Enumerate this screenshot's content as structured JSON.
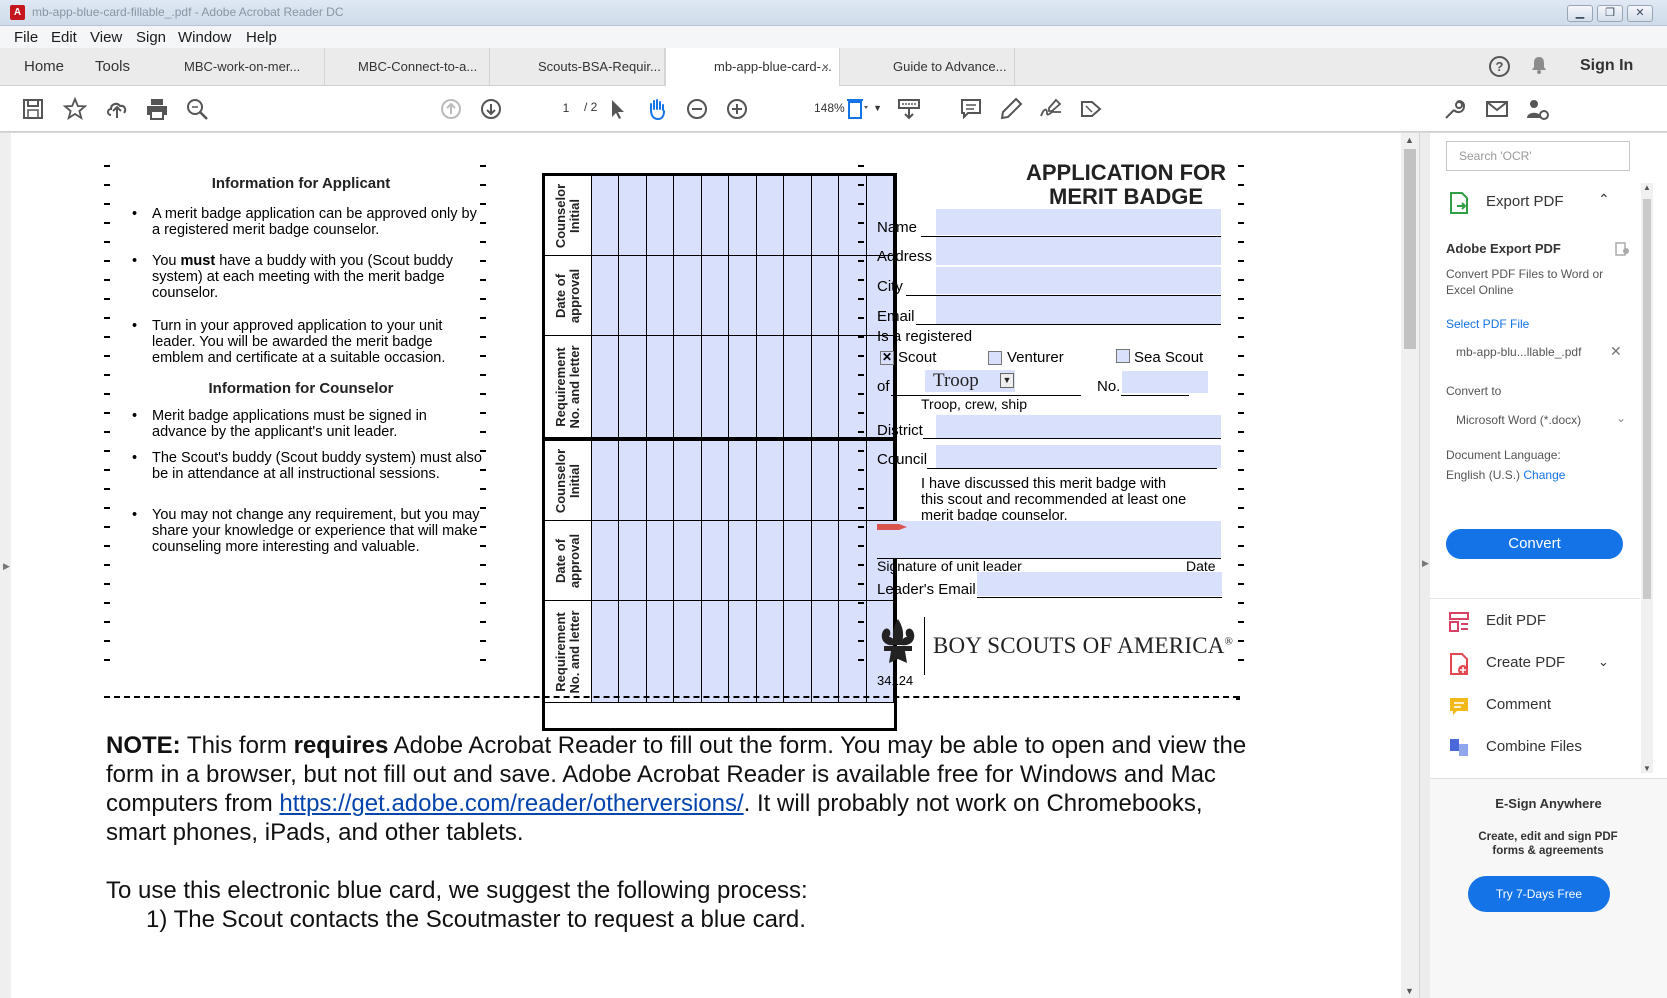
{
  "window": {
    "title": "mb-app-blue-card-fillable_.pdf - Adobe Acrobat Reader DC"
  },
  "menu": [
    "File",
    "Edit",
    "View",
    "Sign",
    "Window",
    "Help"
  ],
  "tabs": {
    "home": "Home",
    "tools": "Tools",
    "docs": [
      "MBC-work-on-mer...",
      "MBC-Connect-to-a...",
      "Scouts-BSA-Requir...",
      "mb-app-blue-card-...",
      "Guide to Advance..."
    ],
    "close": "×",
    "sign_in": "Sign In"
  },
  "toolbar": {
    "page_current": "1",
    "page_total": "/ 2",
    "zoom": "148%"
  },
  "form": {
    "applicant_heading": "Information for Applicant",
    "applicant_bullets": [
      "A merit badge application can be approved only by a registered merit badge counselor.",
      "have a buddy with you (Scout buddy system) at each meeting with the merit badge counselor.",
      "Turn in your approved application to your unit leader. You will be awarded the merit badge emblem and certificate at a suitable occasion."
    ],
    "bullet2_prefix": "You ",
    "bullet2_bold": "must",
    "counselor_heading": "Information for Counselor",
    "counselor_bullets": [
      "Merit badge applications must be signed in advance by the applicant's unit leader.",
      "The Scout's buddy (Scout buddy system) must also be in attendance at all instructional sessions.",
      "You may not change any requirement, but you may share your knowledge or experience that will make counseling more interesting and valuable."
    ],
    "grid_labels": [
      "Counselor Initial",
      "Date of approval",
      "Requirement No. and letter"
    ],
    "title_line1": "APPLICATION FOR",
    "title_line2": "MERIT BADGE",
    "name_label": "Name",
    "address_label": "Address",
    "city_label": "City",
    "email_label": "Email",
    "registered_label": "Is a registered",
    "scout_label": "Scout",
    "venturer_label": "Venturer",
    "sea_scout_label": "Sea Scout",
    "of_label": "of",
    "unit_type_value": "Troop",
    "no_label": "No.",
    "unit_caption": "Troop, crew, ship",
    "district_label": "District",
    "council_label": "Council",
    "discussed_text": "I have discussed this merit badge with this scout and recommended at least one merit badge counselor.",
    "signature_label": "Signature of unit leader",
    "date_label": "Date",
    "leader_email_label": "Leader's Email",
    "bsa_name": "BOY SCOUTS OF AMERICA",
    "reg_mark": "®",
    "form_number": "34124"
  },
  "note": {
    "label": "NOTE:",
    "t1": " This form ",
    "bold": "requires",
    "t2": " Adobe Acrobat Reader to fill out the form. You may be able to open and view the form in a browser, but not fill out and save. Adobe Acrobat Reader is available free for Windows and Mac computers from ",
    "link": "https://get.adobe.com/reader/otherversions/",
    "t3": ". It will probably not work on Chromebooks, smart phones, iPads, and other tablets.",
    "process_intro": "To use this electronic blue card, we suggest the following process:",
    "step1": "1)  The Scout contacts the Scoutmaster to request a blue card."
  },
  "right_pane": {
    "search_placeholder": "Search 'OCR'",
    "export_pdf": "Export PDF",
    "adobe_export_title": "Adobe Export PDF",
    "adobe_export_desc": "Convert PDF Files to Word or Excel Online",
    "select_file": "Select PDF File",
    "file_name": "mb-app-blu...llable_.pdf",
    "convert_to": "Convert to",
    "format": "Microsoft Word (*.docx)",
    "doc_language": "Document Language:",
    "language_value": "English (U.S.)",
    "change": "Change",
    "convert_btn": "Convert",
    "edit_pdf": "Edit PDF",
    "create_pdf": "Create PDF",
    "comment": "Comment",
    "combine": "Combine Files",
    "esign_title": "E-Sign Anywhere",
    "esign_desc": "Create, edit and sign PDF forms & agreements",
    "trial_btn": "Try 7-Days Free"
  },
  "colors": {
    "accent": "#1473e6",
    "field_fill": "#d9e0fb",
    "link": "#0645ad"
  }
}
